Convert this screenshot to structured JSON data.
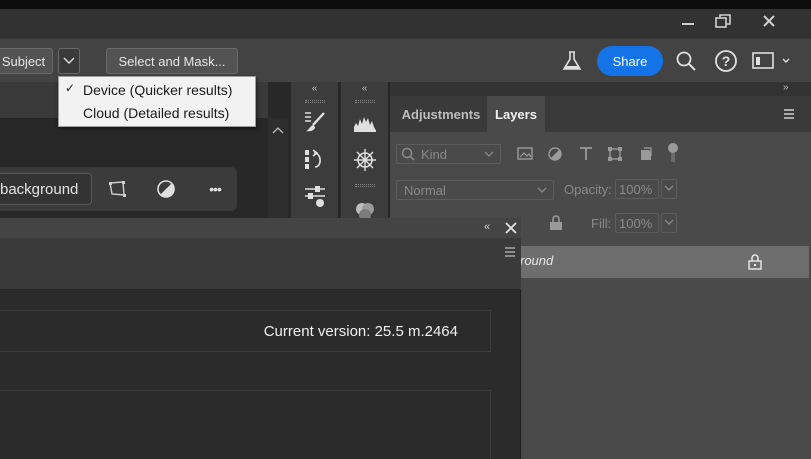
{
  "window": {
    "minimize_label": "—",
    "restore_label": "❐",
    "close_label": "✕"
  },
  "options_bar": {
    "subject_label": "Subject",
    "select_mask_label": "Select and Mask...",
    "share_label": "Share"
  },
  "dropdown": {
    "items": [
      {
        "label": "Device (Quicker results)",
        "checked": true,
        "check": "✓"
      },
      {
        "label": "Cloud (Detailed results)",
        "checked": false,
        "check": ""
      }
    ]
  },
  "context_bar": {
    "background_label": "background",
    "more_label": "•••"
  },
  "panels": {
    "collapse_left": "«",
    "collapse_right": "»",
    "tabs": [
      {
        "label": "Adjustments",
        "active": false
      },
      {
        "label": "Layers",
        "active": true
      }
    ],
    "filter_kind": "Kind",
    "blend_mode": "Normal",
    "opacity_label": "Opacity:",
    "opacity_value": "100%",
    "fill_label": "Fill:",
    "fill_value": "100%",
    "layer_name": "round"
  },
  "dialog": {
    "collapse_label": "«",
    "close_label": "✕",
    "version_text": "Current version: 25.5 m.2464"
  },
  "colors": {
    "accent": "#1473e6",
    "panel": "#4a4a4a",
    "dark": "#282828"
  }
}
